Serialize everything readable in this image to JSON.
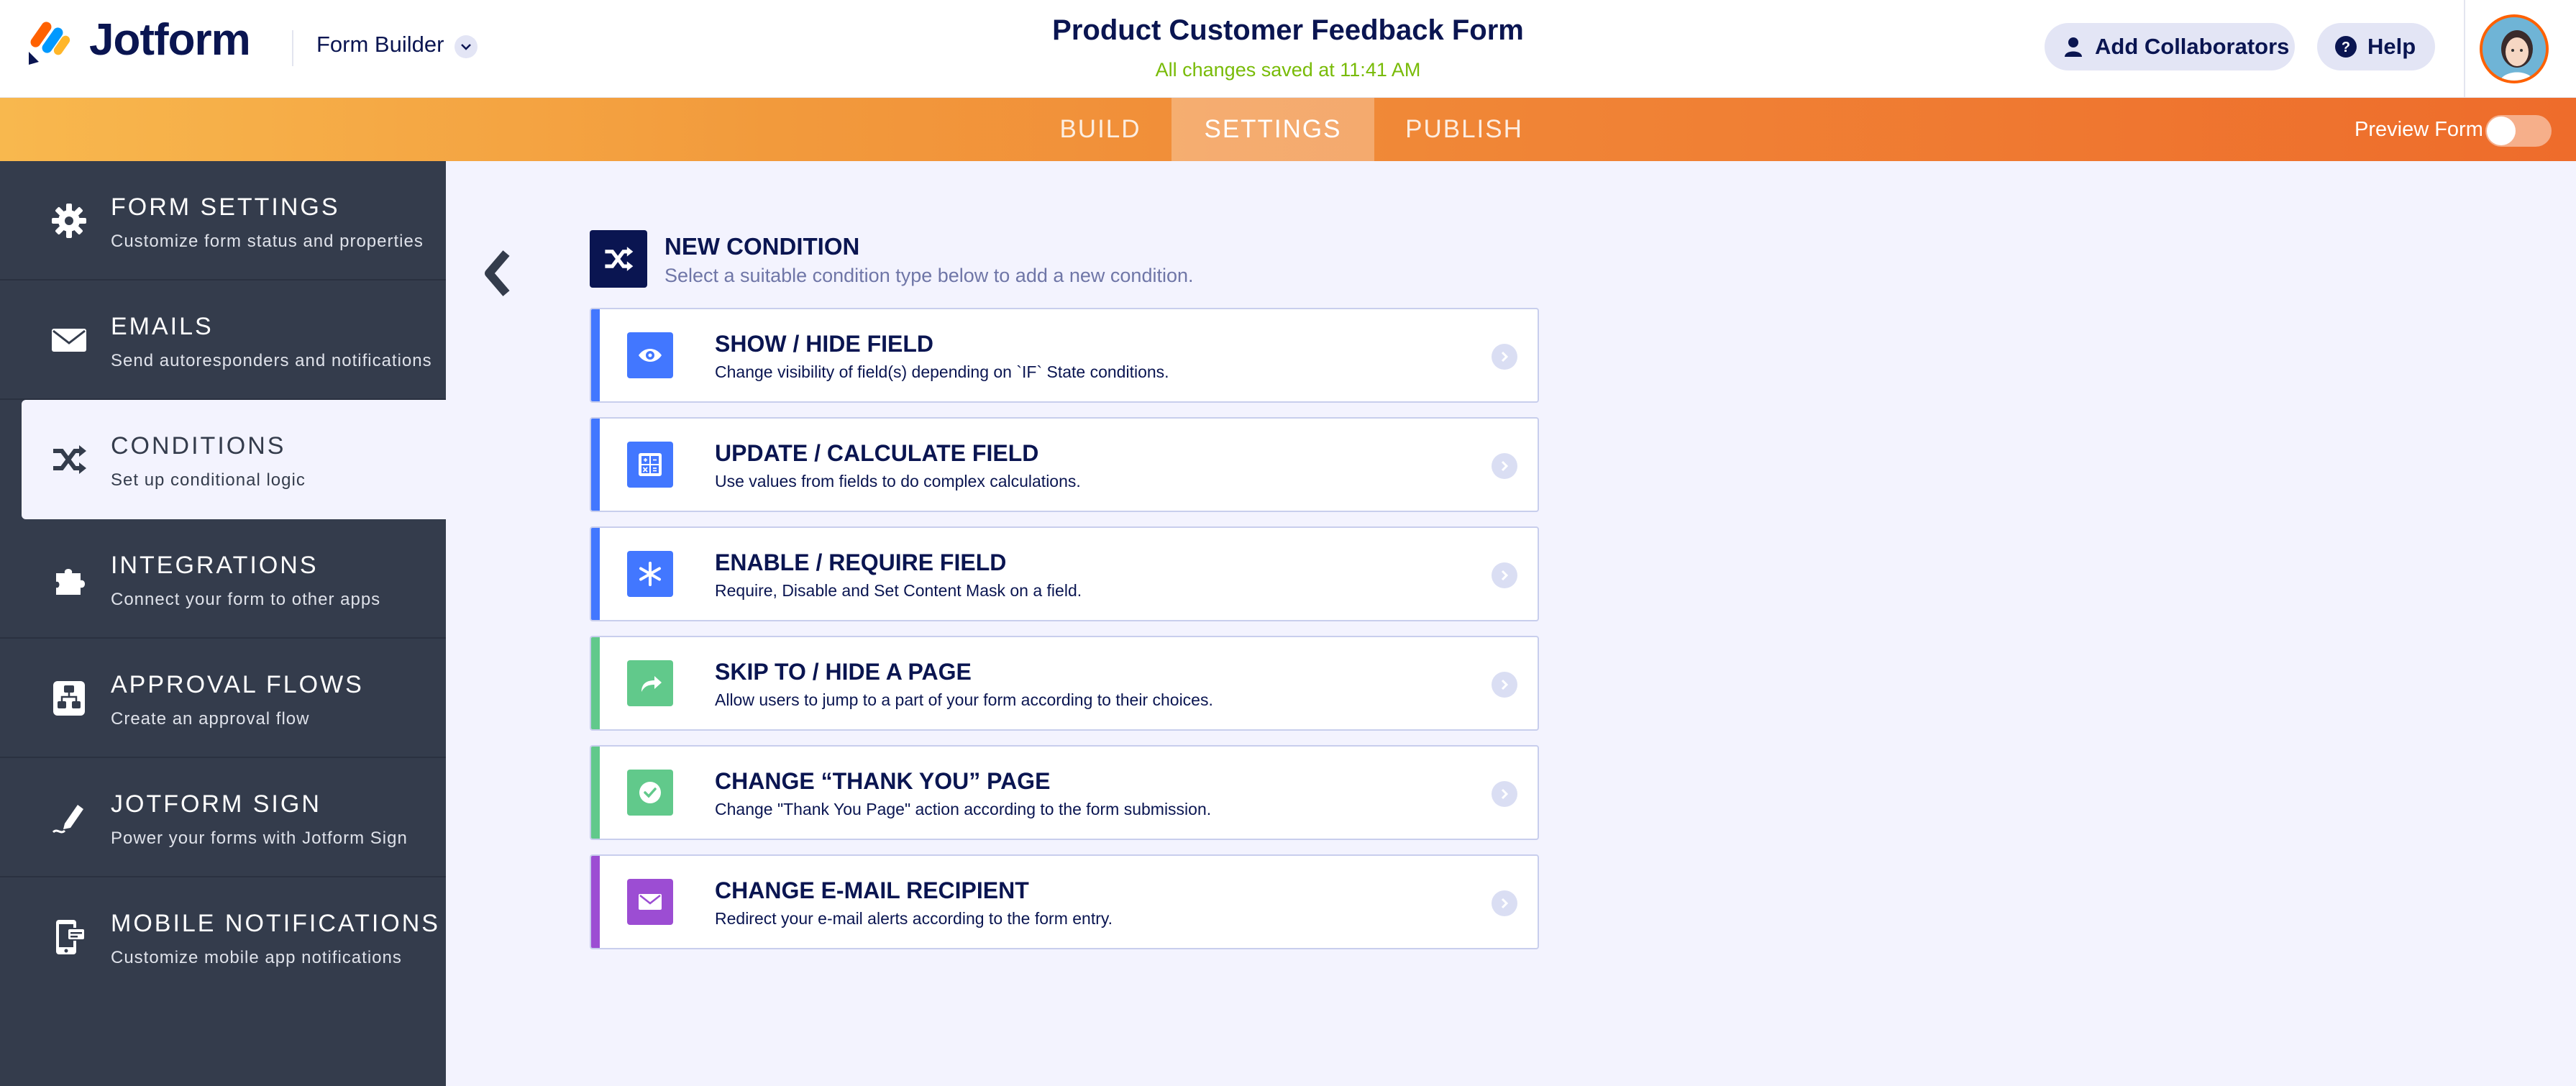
{
  "header": {
    "brand": "Jotform",
    "builder_label": "Form Builder",
    "form_title": "Product Customer Feedback Form",
    "saved_status": "All changes saved at 11:41 AM",
    "add_collaborators": "Add Collaborators",
    "help": "Help"
  },
  "nav": {
    "tabs": [
      {
        "label": "BUILD"
      },
      {
        "label": "SETTINGS"
      },
      {
        "label": "PUBLISH"
      }
    ],
    "preview_label": "Preview Form",
    "preview_on": false
  },
  "sidebar": {
    "items": [
      {
        "title": "FORM SETTINGS",
        "sub": "Customize form status and properties",
        "icon": "gear-icon"
      },
      {
        "title": "EMAILS",
        "sub": "Send autoresponders and notifications",
        "icon": "envelope-icon"
      },
      {
        "title": "CONDITIONS",
        "sub": "Set up conditional logic",
        "icon": "shuffle-icon"
      },
      {
        "title": "INTEGRATIONS",
        "sub": "Connect your form to other apps",
        "icon": "puzzle-icon"
      },
      {
        "title": "APPROVAL FLOWS",
        "sub": "Create an approval flow",
        "icon": "flow-icon"
      },
      {
        "title": "JOTFORM SIGN",
        "sub": "Power your forms with Jotform Sign",
        "icon": "pen-icon"
      },
      {
        "title": "MOBILE NOTIFICATIONS",
        "sub": "Customize mobile app notifications",
        "icon": "mobile-icon"
      }
    ],
    "active_index": 2
  },
  "main": {
    "title": "NEW CONDITION",
    "subtitle": "Select a suitable condition type below to add a new condition.",
    "cards": [
      {
        "title": "SHOW / HIDE FIELD",
        "desc": "Change visibility of field(s) depending on `IF` State conditions.",
        "color": "#4277ff",
        "icon": "eye-icon"
      },
      {
        "title": "UPDATE / CALCULATE FIELD",
        "desc": "Use values from fields to do complex calculations.",
        "color": "#4277ff",
        "icon": "calculator-icon"
      },
      {
        "title": "ENABLE / REQUIRE FIELD",
        "desc": "Require, Disable and Set Content Mask on a field.",
        "color": "#4277ff",
        "icon": "asterisk-icon"
      },
      {
        "title": "SKIP TO / HIDE A PAGE",
        "desc": "Allow users to jump to a part of your form according to their choices.",
        "color": "#61c98b",
        "icon": "share-arrow-icon"
      },
      {
        "title": "CHANGE “THANK YOU” PAGE",
        "desc": "Change \"Thank You Page\" action according to the form submission.",
        "color": "#61c98b",
        "icon": "check-circle-icon"
      },
      {
        "title": "CHANGE E-MAIL RECIPIENT",
        "desc": "Redirect your e-mail alerts according to the form entry.",
        "color": "#9c4dd3",
        "icon": "envelope-icon"
      }
    ]
  },
  "colors": {
    "brand_navy": "#0a1551",
    "saved_green": "#78bb07",
    "sidebar_bg": "#343c4c",
    "blue_stripe": "#4277ff",
    "green_stripe": "#61c98b",
    "purple_stripe": "#9c4dd3"
  }
}
